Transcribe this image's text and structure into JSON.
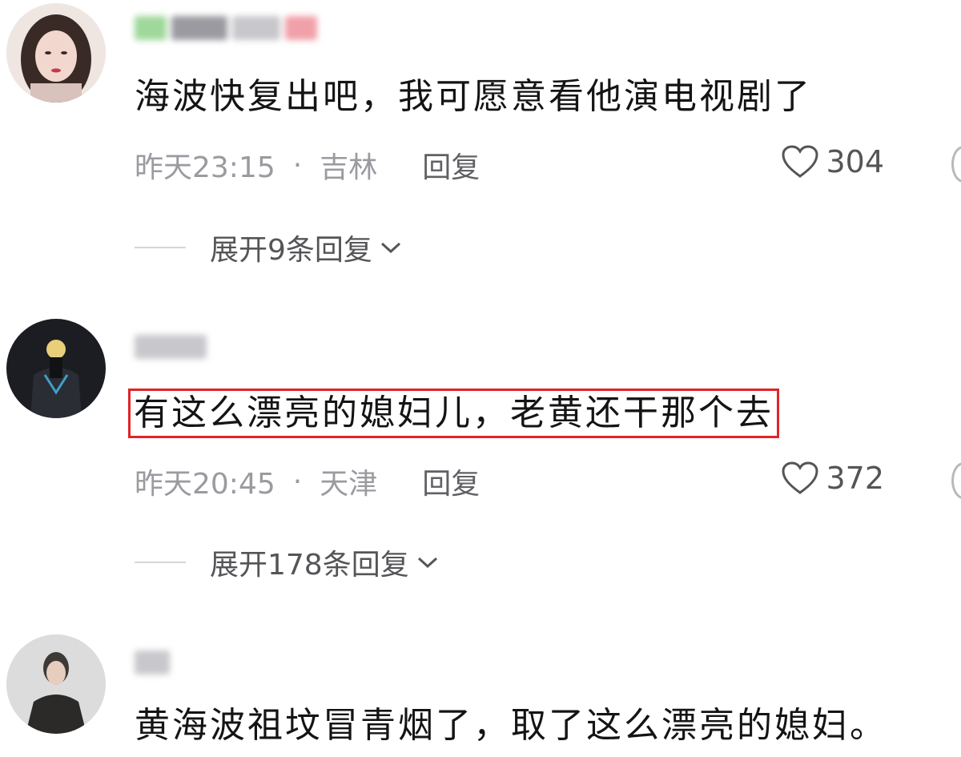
{
  "comments": [
    {
      "content": "海波快复出吧，我可愿意看他演电视剧了",
      "time": "昨天23:15",
      "separator": "·",
      "location": "吉林",
      "reply_label": "回复",
      "likes": "304",
      "expand_label": "展开9条回复"
    },
    {
      "content": "有这么漂亮的媳妇儿，老黄还干那个去",
      "time": "昨天20:45",
      "separator": "·",
      "location": "天津",
      "reply_label": "回复",
      "likes": "372",
      "expand_label": "展开178条回复"
    },
    {
      "content": "黄海波祖坟冒青烟了，取了这么漂亮的媳妇。"
    }
  ],
  "colors": {
    "highlight_border": "#e0242a",
    "meta_text": "#9a9aa0",
    "body_text": "#141414"
  },
  "icons": {
    "like": "heart-outline-icon",
    "expand": "chevron-down-icon"
  }
}
